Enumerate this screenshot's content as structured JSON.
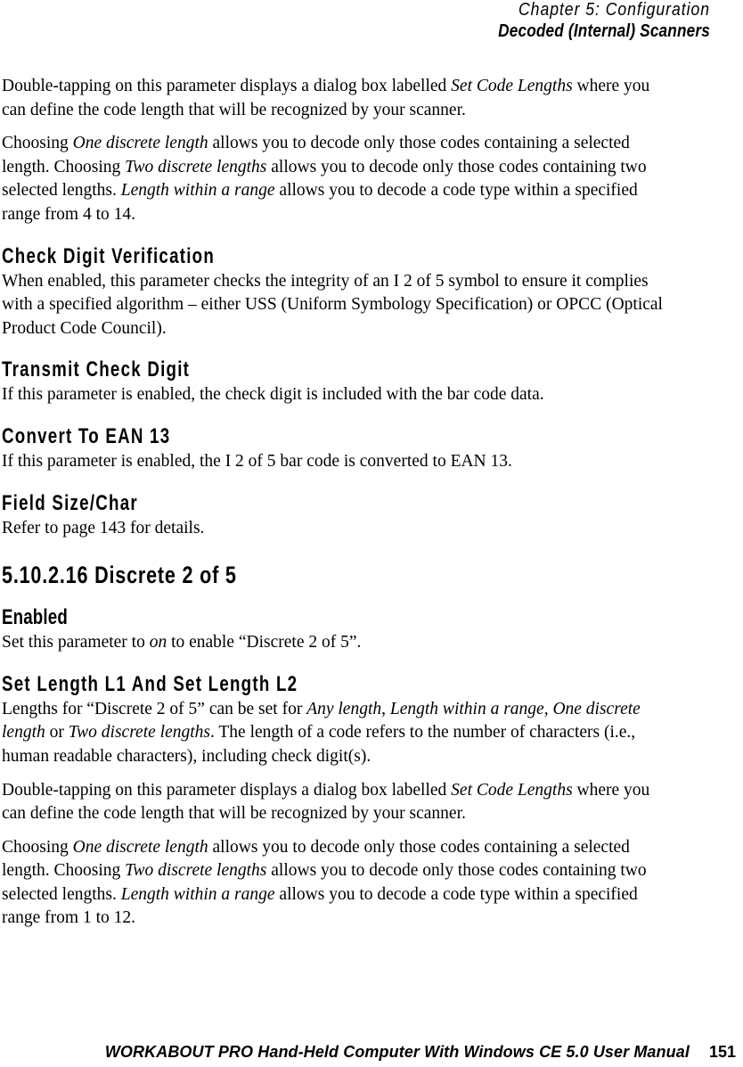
{
  "header": {
    "chapter": "Chapter 5: Configuration",
    "section": "Decoded (Internal) Scanners"
  },
  "content": {
    "para_1_a": "Double-tapping on this parameter displays a dialog box labelled ",
    "para_1_i1": "Set Code Lengths",
    "para_1_b": " where you can define the code length that will be recognized by your scanner.",
    "para_2_a": "Choosing ",
    "para_2_i1": "One discrete length",
    "para_2_b": " allows you to decode only those codes containing a selected length. Choosing ",
    "para_2_i2": "Two discrete lengths",
    "para_2_c": " allows you to decode only those codes containing two selected lengths. ",
    "para_2_i3": "Length within a range",
    "para_2_d": " allows you to decode a code type within a specified range from 4 to 14.",
    "heading_check_digit": "Check Digit Verification",
    "para_3": "When enabled, this parameter checks the integrity of an I 2 of 5 symbol to ensure it complies with a specified algorithm – either USS (Uniform Symbology Specification) or OPCC (Optical Product Code Council).",
    "heading_transmit": "Transmit Check Digit",
    "para_4": "If this parameter is enabled, the check digit is included with the bar code data.",
    "heading_convert": "Convert To EAN 13",
    "para_5": "If this parameter is enabled, the I 2 of 5 bar code is converted to EAN 13.",
    "heading_field_size": "Field Size/Char",
    "para_6": "Refer to page 143 for details.",
    "section_number_heading": "5.10.2.16  Discrete 2 of 5",
    "heading_enabled": "Enabled",
    "para_7_a": "Set this parameter to ",
    "para_7_i1": "on",
    "para_7_b": " to enable “Discrete 2 of 5”.",
    "heading_set_length": "Set Length L1 And Set Length L2",
    "para_8_a": "Lengths for “Discrete 2 of 5” can be set for ",
    "para_8_i1": "Any length",
    "para_8_b": ", ",
    "para_8_i2": "Length within a range",
    "para_8_c": ", ",
    "para_8_i3": "One discrete length",
    "para_8_d": " or ",
    "para_8_i4": "Two discrete lengths",
    "para_8_e": ". The length of a code refers to the number of characters (i.e., human readable characters), including check digit(s).",
    "para_9_a": "Double-tapping on this parameter displays a dialog box labelled ",
    "para_9_i1": "Set Code Lengths",
    "para_9_b": " where you can define the code length that will be recognized by your scanner.",
    "para_10_a": "Choosing ",
    "para_10_i1": "One discrete length",
    "para_10_b": " allows you to decode only those codes containing a selected length. Choosing ",
    "para_10_i2": "Two discrete lengths",
    "para_10_c": " allows you to decode only those codes containing two selected lengths. ",
    "para_10_i3": "Length within a range",
    "para_10_d": " allows you to decode a code type within a specified range from 1 to 12."
  },
  "footer": {
    "title": "WORKABOUT PRO Hand-Held Computer With Windows CE 5.0 User Manual",
    "page_number": "151"
  }
}
